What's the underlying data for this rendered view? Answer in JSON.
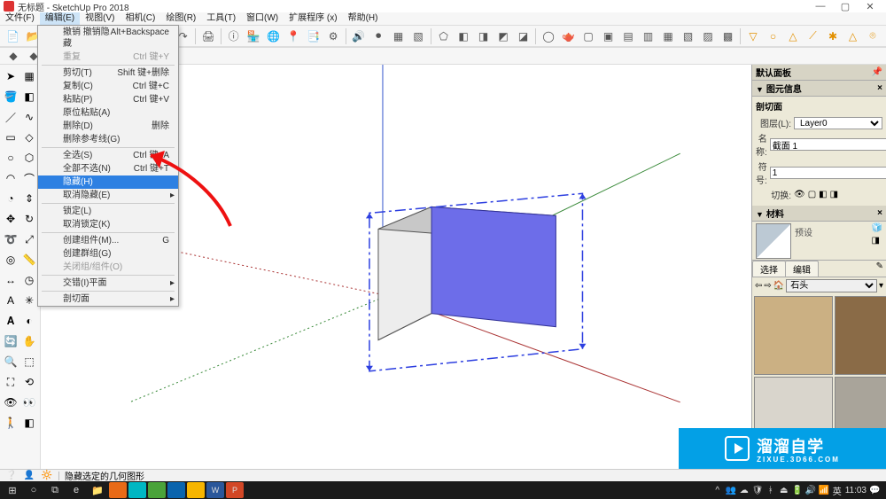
{
  "window": {
    "title": "无标题 - SketchUp Pro 2018",
    "minimize": "—",
    "maximize": "▢",
    "close": "✕"
  },
  "menubar": [
    "文件(F)",
    "编辑(E)",
    "视图(V)",
    "相机(C)",
    "绘图(R)",
    "工具(T)",
    "窗口(W)",
    "扩展程序 (x)",
    "帮助(H)"
  ],
  "edit_menu": {
    "items": [
      {
        "label": "撤销 撤销隐藏",
        "shortcut": "Alt+Backspace",
        "disabled": false
      },
      {
        "label": "重复",
        "shortcut": "Ctrl 键+Y",
        "disabled": true
      },
      {
        "sep": true
      },
      {
        "label": "剪切(T)",
        "shortcut": "Shift 键+删除"
      },
      {
        "label": "复制(C)",
        "shortcut": "Ctrl 键+C"
      },
      {
        "label": "粘贴(P)",
        "shortcut": "Ctrl 键+V"
      },
      {
        "label": "原位粘贴(A)",
        "shortcut": ""
      },
      {
        "label": "删除(D)",
        "shortcut": "删除"
      },
      {
        "label": "删除参考线(G)",
        "shortcut": ""
      },
      {
        "sep": true
      },
      {
        "label": "全选(S)",
        "shortcut": "Ctrl 键+A"
      },
      {
        "label": "全部不选(N)",
        "shortcut": "Ctrl 键+T"
      },
      {
        "label": "隐藏(H)",
        "shortcut": "",
        "highlight": true
      },
      {
        "label": "取消隐藏(E)",
        "shortcut": "",
        "submenu": true
      },
      {
        "sep": true
      },
      {
        "label": "锁定(L)",
        "shortcut": ""
      },
      {
        "label": "取消锁定(K)",
        "shortcut": ""
      },
      {
        "sep": true
      },
      {
        "label": "创建组件(M)...",
        "shortcut": "G"
      },
      {
        "label": "创建群组(G)",
        "shortcut": ""
      },
      {
        "label": "关闭组/组件(O)",
        "shortcut": "",
        "disabled": true
      },
      {
        "sep": true
      },
      {
        "label": "交错(I)平面",
        "shortcut": "",
        "submenu": true
      },
      {
        "sep": true
      },
      {
        "label": "剖切面",
        "shortcut": "",
        "submenu": true
      }
    ]
  },
  "right": {
    "tray_title": "默认面板",
    "entity_info": {
      "title": "图元信息",
      "header": "剖切面",
      "layer_label": "图层(L):",
      "layer_value": "Layer0",
      "name_label": "名称:",
      "name_value": "截面 1",
      "symbol_label": "符号:",
      "symbol_value": "1",
      "toggle_label": "切换:"
    },
    "materials": {
      "title": "材料",
      "preview_name": "预设",
      "tab_select": "选择",
      "tab_edit": "编辑",
      "category": "石头"
    }
  },
  "status": {
    "text": "隐藏选定的几何图形"
  },
  "taskbar": {
    "time": "11:03"
  },
  "watermark": {
    "big": "溜溜自学",
    "small": "ZIXUE.3D66.COM"
  }
}
